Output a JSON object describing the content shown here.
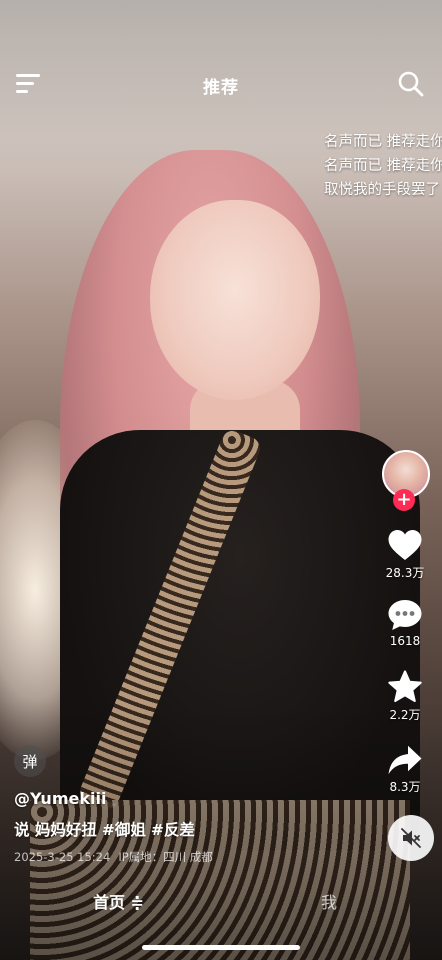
{
  "header": {
    "title": "推荐",
    "menu_icon": "menu-icon",
    "search_icon": "search-icon"
  },
  "danmaku": [
    "名声而已 推荐走你",
    "名声而已 推荐走你",
    "取悦我的手段罢了"
  ],
  "rail": {
    "like_count": "28.3万",
    "comment_count": "1618",
    "favorite_count": "2.2万",
    "share_count": "8.3万",
    "follow_symbol": "+"
  },
  "post": {
    "danmu_toggle": "弹",
    "author": "@Yumekiii",
    "description_text": "说 妈妈好扭",
    "hashtags": [
      "#御姐",
      "#反差"
    ],
    "datetime": "2025-3-25 15:24",
    "ip_location": "IP属地：四川 成都"
  },
  "nav": {
    "home_label": "首页 ≑",
    "me_label": "我"
  },
  "colors": {
    "follow_badge": "#fe2c55",
    "text": "#ffffff"
  }
}
